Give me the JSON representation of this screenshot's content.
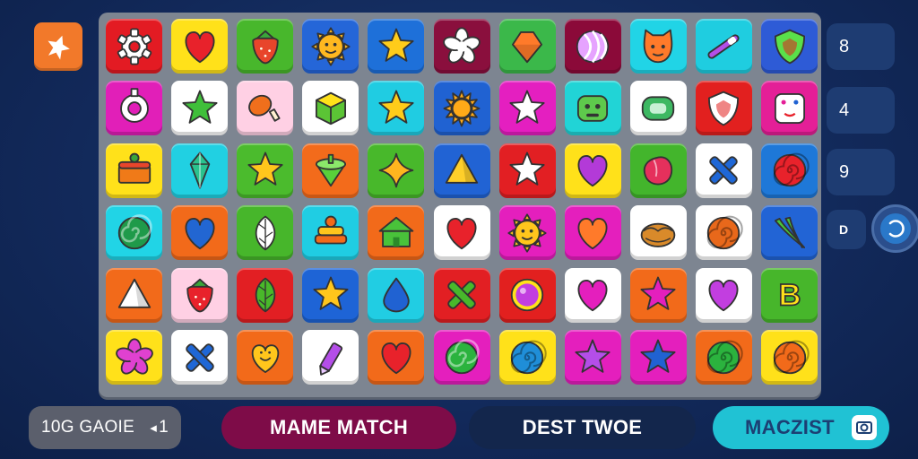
{
  "colors": {
    "background": "#12295a",
    "board": "#7d8591",
    "corner_button": "#f2792a",
    "counter": "#1e3c72"
  },
  "corner_button": {
    "icon": "sparkle-icon"
  },
  "counters": [
    "8",
    "4",
    "9",
    "D"
  ],
  "action_button": {
    "icon": "refresh-icon"
  },
  "bottom_bar": {
    "mode_label": "10G GAOIE",
    "mode_count": "1",
    "match_button": "MAME MATCH",
    "best_label": "DEST TWOE",
    "extra_button": "MACZIST",
    "extra_icon": "camera-icon"
  },
  "board": {
    "rows": [
      [
        {
          "bg": "#e31b23",
          "icon": "gear",
          "fg": "#ffffff"
        },
        {
          "bg": "#ffe11a",
          "icon": "heart",
          "fg": "#e8222b"
        },
        {
          "bg": "#48b72c",
          "icon": "strawberry",
          "fg": "#e8452b"
        },
        {
          "bg": "#2566d8",
          "icon": "sun-face",
          "fg": "#ffb820"
        },
        {
          "bg": "#1e70d9",
          "icon": "star",
          "fg": "#ffcc1a"
        },
        {
          "bg": "#8a0f3d",
          "icon": "flower",
          "fg": "#ffffff"
        },
        {
          "bg": "#3bb84a",
          "icon": "gem",
          "fg": "#ff7a2a"
        },
        {
          "bg": "#8b0a39",
          "icon": "striped-ball",
          "fg": "#e6a3ff"
        },
        {
          "bg": "#21d4e6",
          "icon": "face",
          "fg": "#ff7a2a"
        },
        {
          "bg": "#1fcde0",
          "icon": "wand",
          "fg": "#b44ee8"
        },
        {
          "bg": "#2e5bd6",
          "icon": "shield",
          "fg": "#5ae04a"
        }
      ],
      [
        {
          "bg": "#e11fb8",
          "icon": "ring",
          "fg": "#ffffff"
        },
        {
          "bg": "#ffffff",
          "icon": "star",
          "fg": "#3fbf3a"
        },
        {
          "bg": "#ffd0e4",
          "icon": "drumstick",
          "fg": "#f06f1c"
        },
        {
          "bg": "#ffffff",
          "icon": "cube",
          "fg": "#5bc435"
        },
        {
          "bg": "#20cce2",
          "icon": "star",
          "fg": "#ffcc1a"
        },
        {
          "bg": "#2062d2",
          "icon": "sun",
          "fg": "#ffaa18"
        },
        {
          "bg": "#e41fc0",
          "icon": "star",
          "fg": "#ffffff"
        },
        {
          "bg": "#21d4d6",
          "icon": "robot",
          "fg": "#5ec94c"
        },
        {
          "bg": "#ffffff",
          "icon": "capsule",
          "fg": "#3db862"
        },
        {
          "bg": "#e2201f",
          "icon": "shield",
          "fg": "#ffffff"
        },
        {
          "bg": "#e41f97",
          "icon": "dice",
          "fg": "#ffffff"
        }
      ],
      [
        {
          "bg": "#ffe11a",
          "icon": "cake",
          "fg": "#f07a18"
        },
        {
          "bg": "#21d0e2",
          "icon": "crystal",
          "fg": "#2bc28e"
        },
        {
          "bg": "#4bbb2d",
          "icon": "star",
          "fg": "#ffc61c"
        },
        {
          "bg": "#f36b1b",
          "icon": "top",
          "fg": "#59d03a"
        },
        {
          "bg": "#48b82b",
          "icon": "sparkle",
          "fg": "#ffb51f"
        },
        {
          "bg": "#2163d4",
          "icon": "pyramid",
          "fg": "#ffcf2a"
        },
        {
          "bg": "#e21f23",
          "icon": "star",
          "fg": "#ffffff"
        },
        {
          "bg": "#ffe11a",
          "icon": "heart",
          "fg": "#b33ad8"
        },
        {
          "bg": "#43b52c",
          "icon": "berry",
          "fg": "#e5305c"
        },
        {
          "bg": "#ffffff",
          "icon": "cross",
          "fg": "#1f67d6"
        },
        {
          "bg": "#1e78d8",
          "icon": "spiral",
          "fg": "#e8222b"
        }
      ],
      [
        {
          "bg": "#21d4e6",
          "icon": "swirl",
          "fg": "#1f9a4a"
        },
        {
          "bg": "#f26a1a",
          "icon": "heart",
          "fg": "#2266d2"
        },
        {
          "bg": "#47b62b",
          "icon": "leaf",
          "fg": "#ffffff"
        },
        {
          "bg": "#20cde3",
          "icon": "stack",
          "fg": "#f26a1a"
        },
        {
          "bg": "#f26a1a",
          "icon": "house",
          "fg": "#49c23a"
        },
        {
          "bg": "#ffffff",
          "icon": "heart",
          "fg": "#e8222b"
        },
        {
          "bg": "#e41fbd",
          "icon": "sun-face",
          "fg": "#ffc61c"
        },
        {
          "bg": "#e41fbd",
          "icon": "heart",
          "fg": "#ff7a2a"
        },
        {
          "bg": "#ffffff",
          "icon": "pie",
          "fg": "#d98a2a"
        },
        {
          "bg": "#ffffff",
          "icon": "spiral",
          "fg": "#e8681b"
        },
        {
          "bg": "#2264d5",
          "icon": "banana",
          "fg": "#47c63a"
        }
      ],
      [
        {
          "bg": "#f26a1a",
          "icon": "pyramid",
          "fg": "#ffffff"
        },
        {
          "bg": "#ffd0e4",
          "icon": "strawberry",
          "fg": "#e8222b"
        },
        {
          "bg": "#e21f23",
          "icon": "leaf",
          "fg": "#49b82a"
        },
        {
          "bg": "#1e64d6",
          "icon": "star",
          "fg": "#ffc61c"
        },
        {
          "bg": "#21cde3",
          "icon": "drop",
          "fg": "#2062d2"
        },
        {
          "bg": "#e21f23",
          "icon": "cross",
          "fg": "#48b82b"
        },
        {
          "bg": "#e2201f",
          "icon": "orb",
          "fg": "#c23ee0"
        },
        {
          "bg": "#ffffff",
          "icon": "heart",
          "fg": "#e41fbd"
        },
        {
          "bg": "#f26a1a",
          "icon": "star",
          "fg": "#e41fbd"
        },
        {
          "bg": "#ffffff",
          "icon": "heart",
          "fg": "#c23ee0"
        },
        {
          "bg": "#47b62b",
          "icon": "letter-b",
          "fg": "#ffe11a"
        }
      ],
      [
        {
          "bg": "#ffe11a",
          "icon": "flower",
          "fg": "#e041d0"
        },
        {
          "bg": "#ffffff",
          "icon": "cross",
          "fg": "#1f67d6"
        },
        {
          "bg": "#f26a1a",
          "icon": "smile",
          "fg": "#ffc61c"
        },
        {
          "bg": "#ffffff",
          "icon": "crayon",
          "fg": "#b44ee8"
        },
        {
          "bg": "#f26a1a",
          "icon": "heart",
          "fg": "#e8222b"
        },
        {
          "bg": "#e41fbd",
          "icon": "swirl",
          "fg": "#2bb33e"
        },
        {
          "bg": "#ffe11a",
          "icon": "spiral",
          "fg": "#1f8ed8"
        },
        {
          "bg": "#e41fbd",
          "icon": "star",
          "fg": "#b44ee8"
        },
        {
          "bg": "#e41fbd",
          "icon": "star",
          "fg": "#2062d2"
        },
        {
          "bg": "#f26a1a",
          "icon": "spiral",
          "fg": "#2bb33e"
        },
        {
          "bg": "#ffe11a",
          "icon": "spiral",
          "fg": "#f26a1a"
        }
      ]
    ]
  }
}
